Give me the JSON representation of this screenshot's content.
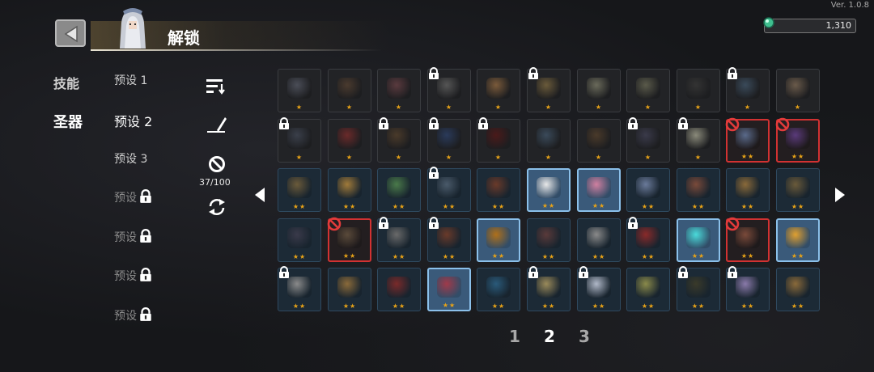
{
  "version": "Ver. 1.0.8",
  "header": {
    "title": "解锁"
  },
  "currency": {
    "amount": "1,310"
  },
  "categories": [
    "技能",
    "圣器"
  ],
  "presets": [
    {
      "label": "预设 1",
      "locked": false
    },
    {
      "label": "预设 2",
      "locked": false,
      "active": true
    },
    {
      "label": "预设 3",
      "locked": false
    },
    {
      "label": "预设",
      "locked": true
    },
    {
      "label": "预设",
      "locked": true
    },
    {
      "label": "预设",
      "locked": true
    },
    {
      "label": "预设",
      "locked": true
    }
  ],
  "tools": {
    "count": "37/100"
  },
  "pagination": [
    "1",
    "2",
    "3"
  ],
  "active_page": "2",
  "grid": [
    [
      {
        "s": "dim",
        "st": 1,
        "c": "#4a4d57"
      },
      {
        "s": "dim",
        "st": 1,
        "c": "#4a3a2e"
      },
      {
        "s": "dim",
        "st": 1,
        "c": "#5a3a3e"
      },
      {
        "s": "dim",
        "st": 1,
        "c": "#555",
        "lock": true
      },
      {
        "s": "dim",
        "st": 1,
        "c": "#7a5a3a"
      },
      {
        "s": "dim",
        "st": 1,
        "c": "#6a5a3a",
        "lock": true
      },
      {
        "s": "dim",
        "st": 1,
        "c": "#6a6a5a"
      },
      {
        "s": "dim",
        "st": 1,
        "c": "#5a5a4a"
      },
      {
        "s": "dim",
        "st": 1,
        "c": "#333"
      },
      {
        "s": "dim",
        "st": 1,
        "c": "#3a4a5a",
        "lock": true
      },
      {
        "s": "dim",
        "st": 1,
        "c": "#6a5a4a"
      }
    ],
    [
      {
        "s": "dim",
        "st": 1,
        "c": "#3a3f4a",
        "lock": true
      },
      {
        "s": "dim",
        "st": 1,
        "c": "#6a2a2a"
      },
      {
        "s": "dim",
        "st": 1,
        "c": "#4a3a2a",
        "lock": true
      },
      {
        "s": "dim",
        "st": 1,
        "c": "#2a3a5a",
        "lock": true
      },
      {
        "s": "dim",
        "st": 1,
        "c": "#4a1a1a",
        "lock": true
      },
      {
        "s": "dim",
        "st": 1,
        "c": "#3a4a5a"
      },
      {
        "s": "dim",
        "st": 1,
        "c": "#4a3a2a"
      },
      {
        "s": "dim",
        "st": 1,
        "c": "#3a3a4a",
        "lock": true
      },
      {
        "s": "dim",
        "st": 1,
        "c": "#8a8a7a",
        "lock": true
      },
      {
        "s": "red",
        "st": 2,
        "c": "#5a6a8a",
        "ban": true
      },
      {
        "s": "red",
        "st": 2,
        "c": "#5a3a7a",
        "ban": true
      }
    ],
    [
      {
        "s": "blue",
        "st": 2,
        "c": "#6a5a3a"
      },
      {
        "s": "blue",
        "st": 2,
        "c": "#a07a3a"
      },
      {
        "s": "blue",
        "st": 2,
        "c": "#4a7a4a"
      },
      {
        "s": "blue",
        "st": 2,
        "c": "#4a5a6a",
        "lock": true
      },
      {
        "s": "blue",
        "st": 2,
        "c": "#6a3a2a"
      },
      {
        "s": "light",
        "st": 2,
        "c": "#e8e8e8"
      },
      {
        "s": "light",
        "st": 2,
        "c": "#d080a0"
      },
      {
        "s": "blue",
        "st": 2,
        "c": "#6a7a9a"
      },
      {
        "s": "blue",
        "st": 2,
        "c": "#7a4a3a"
      },
      {
        "s": "blue",
        "st": 2,
        "c": "#8a6a3a"
      },
      {
        "s": "blue",
        "st": 2,
        "c": "#6a5a3a"
      }
    ],
    [
      {
        "s": "blue",
        "st": 2,
        "c": "#3a3a4a"
      },
      {
        "s": "red",
        "st": 2,
        "c": "#5a4a3a",
        "ban": true
      },
      {
        "s": "blue",
        "st": 2,
        "c": "#6a6a6a",
        "lock": true
      },
      {
        "s": "blue",
        "st": 2,
        "c": "#6a3a2a",
        "lock": true
      },
      {
        "s": "light",
        "st": 2,
        "c": "#b0701a"
      },
      {
        "s": "blue",
        "st": 2,
        "c": "#5a3a3a"
      },
      {
        "s": "blue",
        "st": 2,
        "c": "#8a8a8a"
      },
      {
        "s": "blue",
        "st": 2,
        "c": "#8a2a2a",
        "lock": true
      },
      {
        "s": "light",
        "st": 2,
        "c": "#4adada"
      },
      {
        "s": "red",
        "st": 2,
        "c": "#7a4a3a",
        "ban": true
      },
      {
        "s": "light",
        "st": 2,
        "c": "#e0a030"
      }
    ],
    [
      {
        "s": "blue",
        "st": 2,
        "c": "#8a8a8a",
        "lock": true
      },
      {
        "s": "blue",
        "st": 2,
        "c": "#8a6a3a"
      },
      {
        "s": "blue",
        "st": 2,
        "c": "#7a2a2a"
      },
      {
        "s": "light",
        "st": 2,
        "c": "#a03a4a"
      },
      {
        "s": "blue",
        "st": 2,
        "c": "#2a5a7a"
      },
      {
        "s": "blue",
        "st": 2,
        "c": "#9a8a5a",
        "lock": true
      },
      {
        "s": "blue",
        "st": 2,
        "c": "#b0b8c8",
        "lock": true
      },
      {
        "s": "blue",
        "st": 2,
        "c": "#8a8a4a"
      },
      {
        "s": "blue",
        "st": 2,
        "c": "#3a3a2a",
        "lock": true
      },
      {
        "s": "blue",
        "st": 2,
        "c": "#8a7aaa",
        "lock": true
      },
      {
        "s": "blue",
        "st": 2,
        "c": "#8a6a3a"
      }
    ]
  ]
}
